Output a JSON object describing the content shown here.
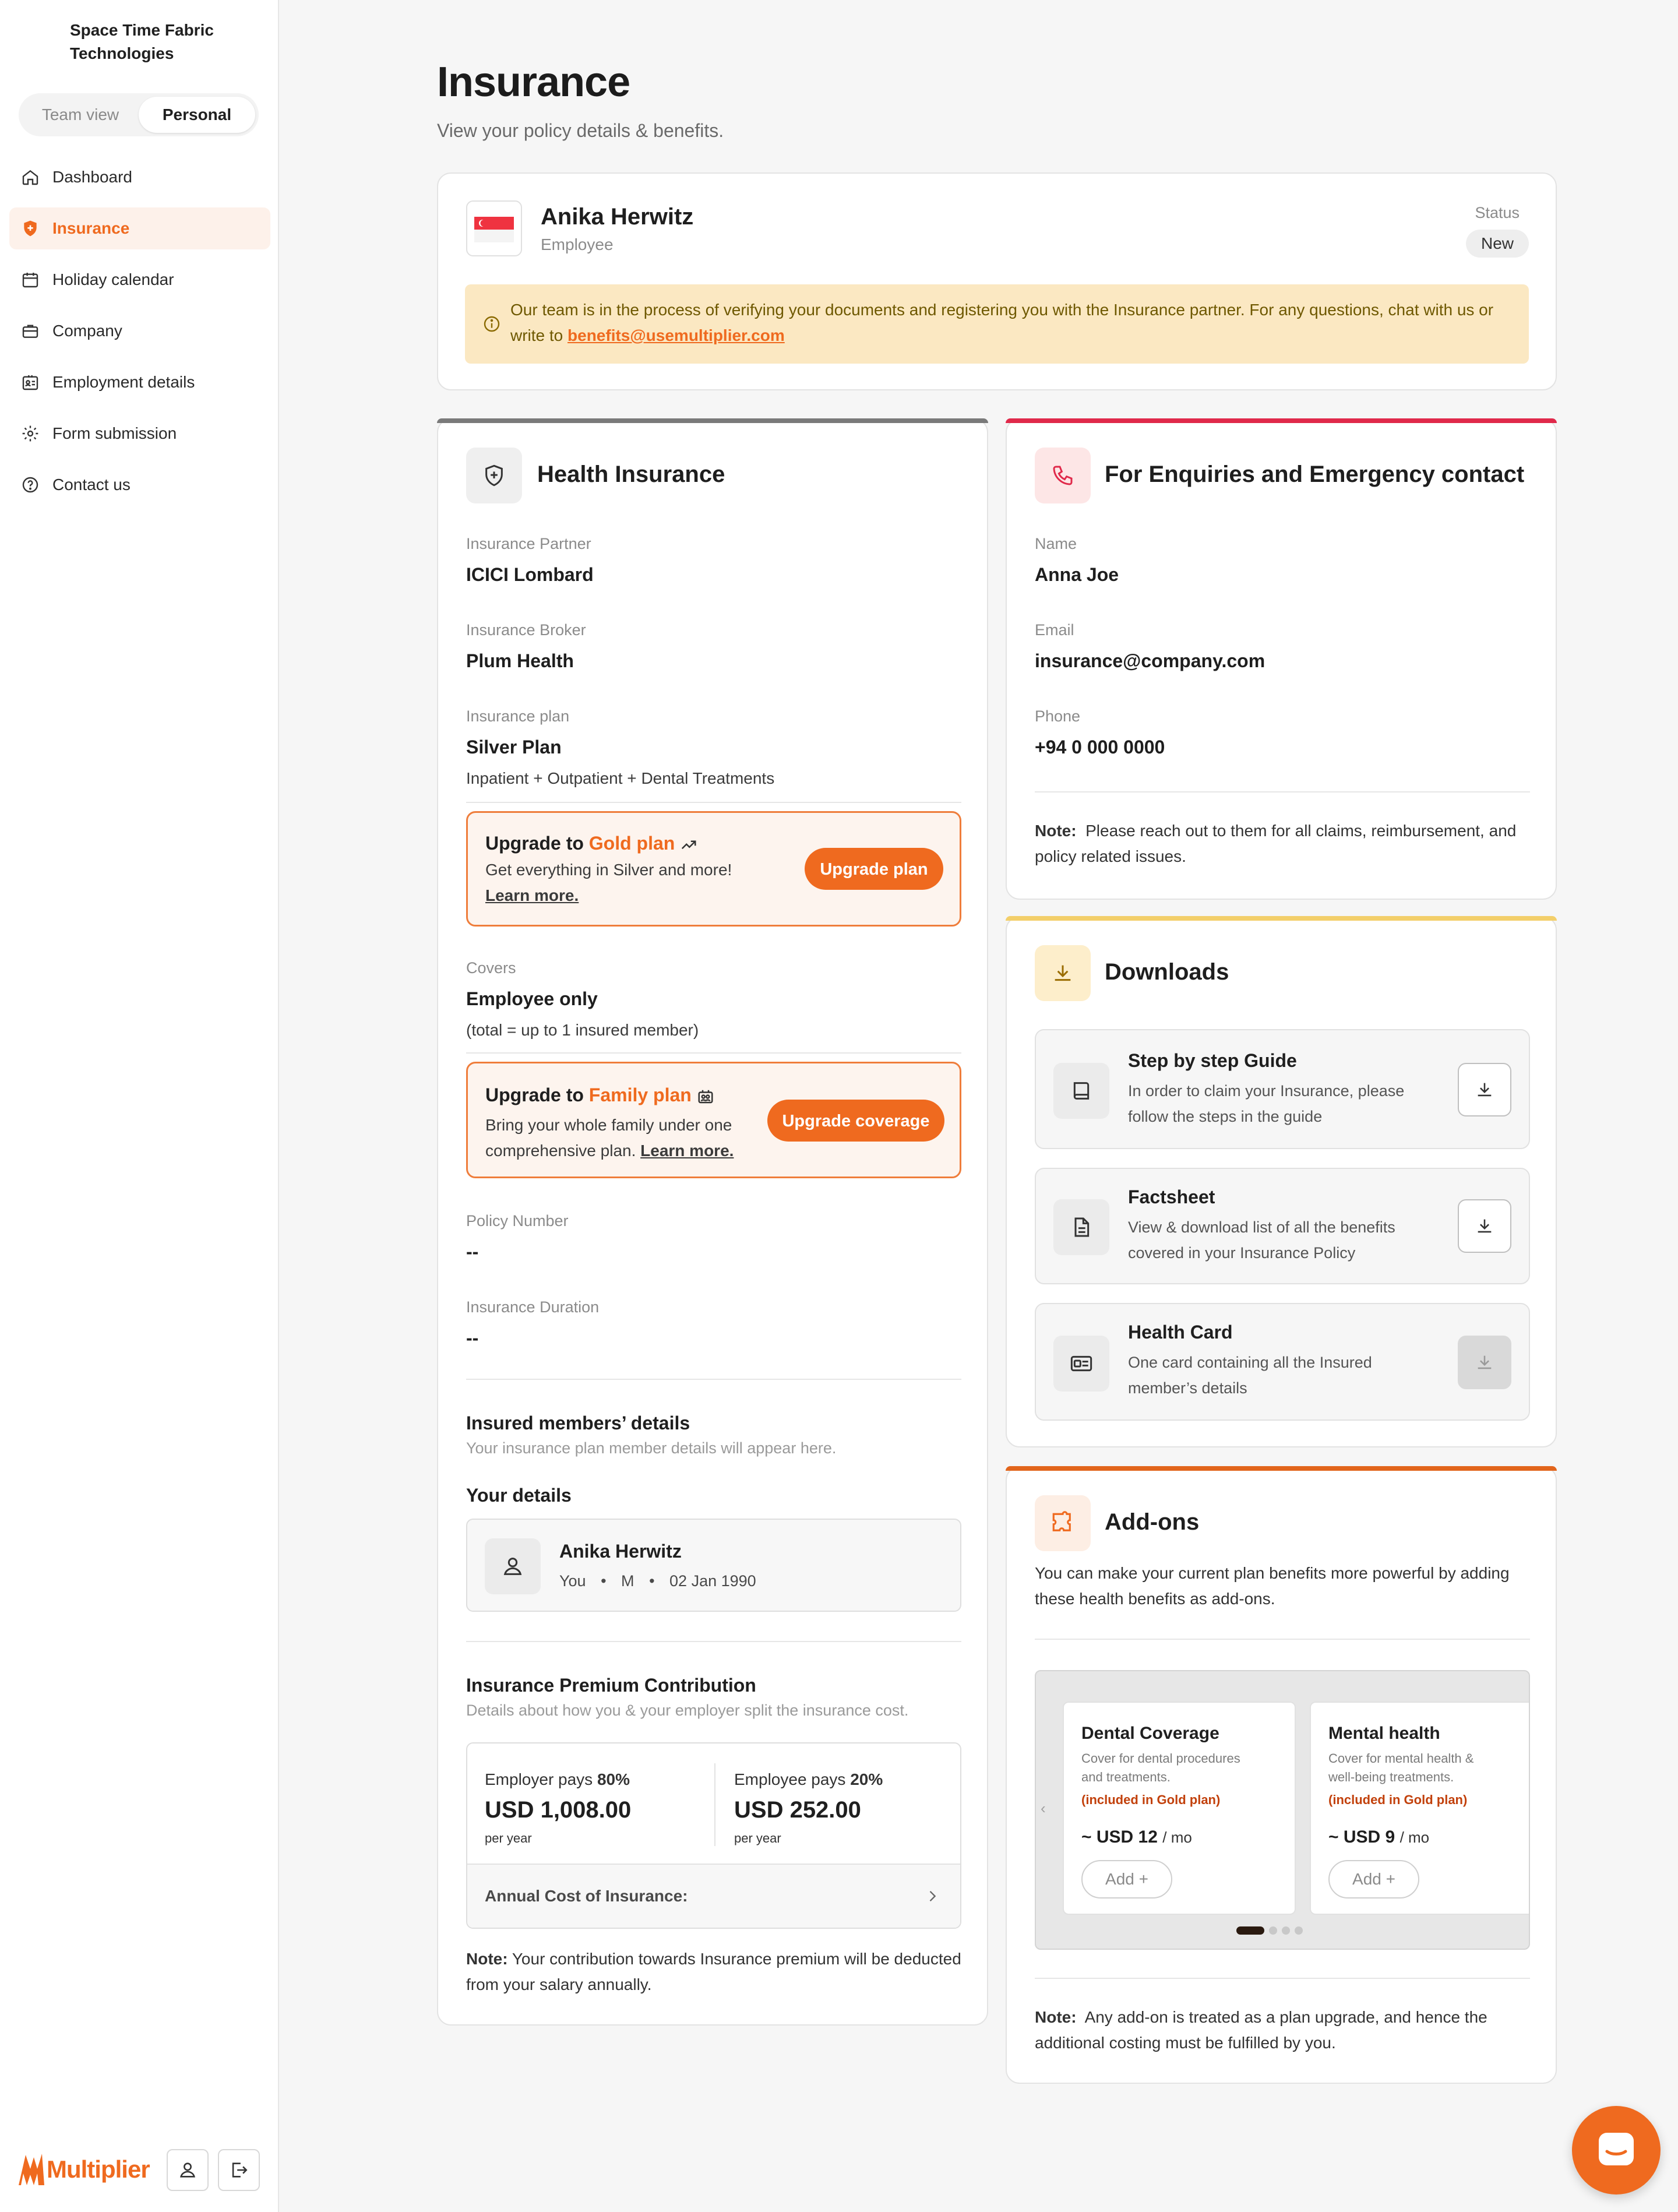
{
  "sidebar": {
    "org_name": "Space Time Fabric Technologies",
    "toggle": {
      "team": "Team view",
      "personal": "Personal"
    },
    "items": [
      {
        "label": "Dashboard",
        "icon": "home-icon"
      },
      {
        "label": "Insurance",
        "icon": "shield-plus-icon",
        "active": true
      },
      {
        "label": "Holiday calendar",
        "icon": "calendar-icon"
      },
      {
        "label": "Company",
        "icon": "briefcase-icon"
      },
      {
        "label": "Employment details",
        "icon": "id-card-icon"
      },
      {
        "label": "Form submission",
        "icon": "gear-icon"
      },
      {
        "label": "Contact us",
        "icon": "help-circle-icon"
      }
    ],
    "brand": "Multiplier"
  },
  "page": {
    "title": "Insurance",
    "subtitle": "View your policy details & benefits."
  },
  "profile": {
    "name": "Anika Herwitz",
    "role": "Employee",
    "status_label": "Status",
    "status": "New",
    "notice_text": "Our team is in the process of verifying your documents and registering you with the Insurance partner. For any questions, chat with us or write to",
    "notice_email": "benefits@usemultiplier.com"
  },
  "health": {
    "title": "Health Insurance",
    "partner_label": "Insurance Partner",
    "partner": "ICICI Lombard",
    "broker_label": "Insurance Broker",
    "broker": "Plum Health",
    "plan_label": "Insurance plan",
    "plan": "Silver Plan",
    "plan_detail": "Inpatient + Outpatient + Dental Treatments",
    "upgrade1": {
      "prefix": "Upgrade to",
      "highlight": "Gold plan",
      "desc": "Get everything in Silver and more!",
      "learn": "Learn more.",
      "button": "Upgrade plan"
    },
    "covers_label": "Covers",
    "covers": "Employee only",
    "covers_detail": "(total = up to 1 insured member)",
    "upgrade2": {
      "prefix": "Upgrade to",
      "highlight": "Family plan",
      "desc1": "Bring your whole family under one",
      "desc2": "comprehensive plan.",
      "learn": "Learn more.",
      "button": "Upgrade coverage"
    },
    "policy_label": "Policy Number",
    "policy": "--",
    "duration_label": "Insurance Duration",
    "duration": "--",
    "members_title": "Insured members’ details",
    "members_sub": "Your insurance plan member details will appear here.",
    "your_details": "Your details",
    "member": {
      "name": "Anika Herwitz",
      "relation": "You",
      "gender": "M",
      "dob": "02 Jan 1990"
    },
    "premium_title": "Insurance Premium Contribution",
    "premium_sub": "Details about how you & your employer split the insurance cost.",
    "employer_label": "Employer pays",
    "employer_pct": "80%",
    "employer_amount": "USD 1,008.00",
    "employee_label": "Employee pays",
    "employee_pct": "20%",
    "employee_amount": "USD 252.00",
    "per_year": "per year",
    "annual_cost": "Annual Cost of Insurance:",
    "note_label": "Note:",
    "note": "Your contribution towards Insurance premium will be deducted from your salary annually."
  },
  "contact": {
    "title": "For Enquiries and Emergency contact",
    "name_label": "Name",
    "name": "Anna Joe",
    "email_label": "Email",
    "email": "insurance@company.com",
    "phone_label": "Phone",
    "phone": "+94 0 000 0000",
    "note_label": "Note:",
    "note": "Please reach out to them for all claims, reimbursement, and policy related issues."
  },
  "downloads": {
    "title": "Downloads",
    "items": [
      {
        "title": "Step by step Guide",
        "desc1": "In order to claim your Insurance, please",
        "desc2": "follow the steps in the guide",
        "icon": "book-icon"
      },
      {
        "title": "Factsheet",
        "desc1": "View & download list of all the benefits",
        "desc2": "covered in your Insurance Policy",
        "icon": "document-icon"
      },
      {
        "title": "Health Card",
        "desc1": "One card containing all the Insured",
        "desc2": "member’s details",
        "icon": "card-icon"
      }
    ]
  },
  "addons": {
    "title": "Add-ons",
    "desc": "You can make your current plan benefits more powerful by adding these health benefits as add-ons.",
    "items": [
      {
        "title": "Dental Coverage",
        "desc1": "Cover for dental procedures",
        "desc2": "and treatments.",
        "tag": "(included in Gold plan)",
        "price": "~ USD 12",
        "unit": "/ mo",
        "add": "Add"
      },
      {
        "title": "Mental health",
        "desc1": "Cover for mental health &",
        "desc2": "well-being treatments.",
        "tag": "(included in Gold plan)",
        "price": "~ USD 9",
        "unit": "/ mo",
        "add": "Add"
      }
    ],
    "note_label": "Note:",
    "note": "Any add-on is treated as a plan upgrade, and hence the additional costing must be fulfilled by you."
  },
  "colors": {
    "accent": "#ef6a1f",
    "red_accent": "#e0294a",
    "yellow_accent": "#f3cf6a"
  }
}
